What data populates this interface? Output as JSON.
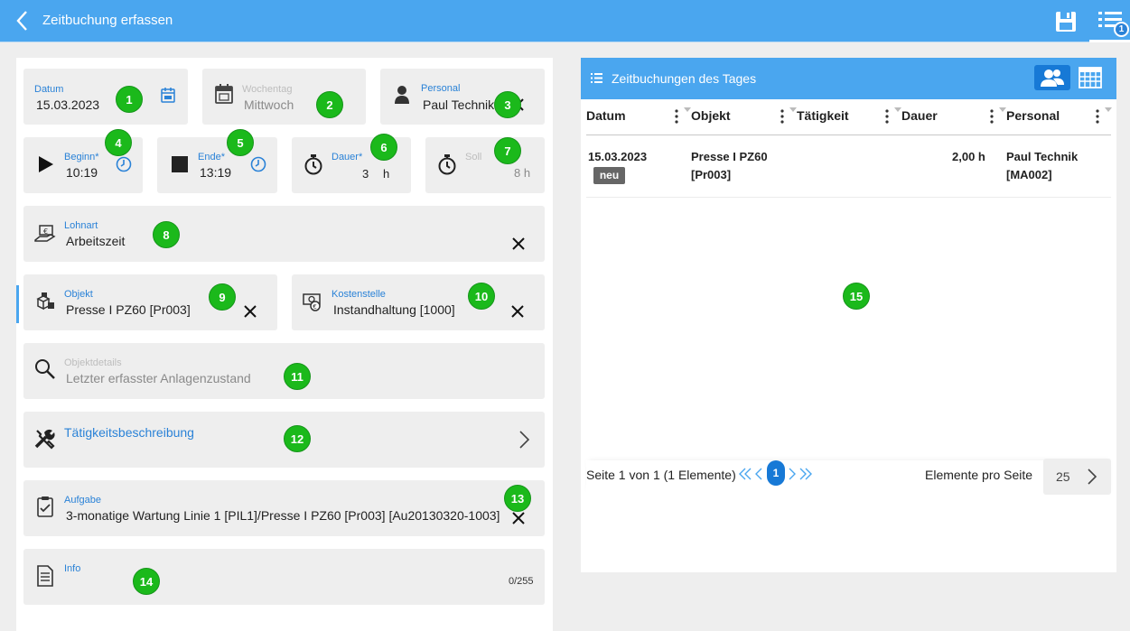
{
  "header": {
    "title": "Zeitbuchung erfassen",
    "list_badge": "1"
  },
  "form": {
    "datum": {
      "label": "Datum",
      "value": "15.03.2023"
    },
    "wochentag": {
      "label": "Wochentag",
      "value": "Mittwoch"
    },
    "personal": {
      "label": "Personal",
      "value": "Paul Technik"
    },
    "beginn": {
      "label": "Beginn*",
      "value": "10:19"
    },
    "ende": {
      "label": "Ende*",
      "value": "13:19"
    },
    "dauer": {
      "label": "Dauer*",
      "value": "3",
      "unit": "h"
    },
    "soll": {
      "label": "Soll",
      "value": "8 h"
    },
    "lohnart": {
      "label": "Lohnart",
      "value": "Arbeitszeit"
    },
    "objekt": {
      "label": "Objekt",
      "value": "Presse I PZ60 [Pr003]"
    },
    "kostenstelle": {
      "label": "Kostenstelle",
      "value": "Instandhaltung [1000]"
    },
    "objektdetails": {
      "label": "Objektdetails",
      "value": "Letzter erfasster Anlagenzustand"
    },
    "taetigkeit": {
      "label": "Tätigkeitsbeschreibung"
    },
    "aufgabe": {
      "label": "Aufgabe",
      "value": "3-monatige Wartung Linie 1 [PIL1]/Presse I PZ60 [Pr003] [Au20130320-1003]"
    },
    "info": {
      "label": "Info",
      "counter": "0/255"
    }
  },
  "markers": [
    "1",
    "2",
    "3",
    "4",
    "5",
    "6",
    "7",
    "8",
    "9",
    "10",
    "11",
    "12",
    "13",
    "14",
    "15"
  ],
  "day_bookings": {
    "title": "Zeitbuchungen des Tages",
    "columns": [
      "Datum",
      "Objekt",
      "Tätigkeit",
      "Dauer",
      "Personal"
    ],
    "rows": [
      {
        "datum": "15.03.2023",
        "badge": "neu",
        "objekt_line1": "Presse I PZ60",
        "objekt_line2": "[Pr003]",
        "taetigkeit": "",
        "dauer": "2,00 h",
        "personal_line1": "Paul Technik",
        "personal_line2": "[MA002]"
      }
    ],
    "pager": {
      "summary": "Seite 1 von 1 (1 Elemente)",
      "current_page": "1",
      "per_page_label": "Elemente pro Seite",
      "per_page": "25"
    }
  },
  "icons": {
    "back": "chevron-left-icon",
    "save": "floppy-disk-icon",
    "list": "list-icon",
    "calendar": "calendar-icon",
    "person": "person-icon",
    "play": "play-icon",
    "stop": "stop-icon",
    "clock": "clock-icon",
    "stopwatch": "stopwatch-icon",
    "close": "close-icon",
    "search": "search-icon",
    "tools": "tools-icon",
    "clipboard": "clipboard-check-icon",
    "document": "document-icon"
  },
  "colors": {
    "primary": "#4aa6ef",
    "accent": "#2a82d7",
    "marker": "#1bb91b",
    "active": "#1779d6"
  }
}
